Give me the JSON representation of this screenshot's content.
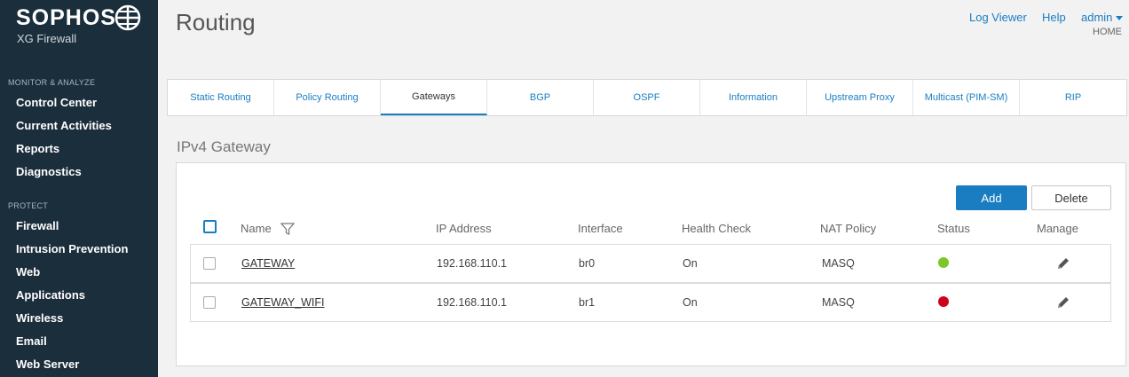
{
  "brand": {
    "name": "SOPHOS",
    "product": "XG Firewall"
  },
  "sidebar": {
    "sections": [
      {
        "label": "MONITOR & ANALYZE",
        "items": [
          "Control Center",
          "Current Activities",
          "Reports",
          "Diagnostics"
        ]
      },
      {
        "label": "PROTECT",
        "items": [
          "Firewall",
          "Intrusion Prevention",
          "Web",
          "Applications",
          "Wireless",
          "Email",
          "Web Server"
        ]
      }
    ]
  },
  "header": {
    "title": "Routing",
    "log_viewer": "Log Viewer",
    "help": "Help",
    "user": "admin",
    "breadcrumb": "HOME"
  },
  "tabs": [
    "Static Routing",
    "Policy Routing",
    "Gateways",
    "BGP",
    "OSPF",
    "Information",
    "Upstream Proxy",
    "Multicast (PIM-SM)",
    "RIP"
  ],
  "active_tab": "Gateways",
  "section": {
    "title": "IPv4 Gateway"
  },
  "actions": {
    "add": "Add",
    "delete": "Delete"
  },
  "table": {
    "columns": [
      "Name",
      "IP Address",
      "Interface",
      "Health Check",
      "NAT Policy",
      "Status",
      "Manage"
    ],
    "rows": [
      {
        "name": "GATEWAY",
        "ip": "192.168.110.1",
        "interface": "br0",
        "health": "On",
        "nat": "MASQ",
        "status": "up",
        "status_color": "#7cc627"
      },
      {
        "name": "GATEWAY_WIFI",
        "ip": "192.168.110.1",
        "interface": "br1",
        "health": "On",
        "nat": "MASQ",
        "status": "down",
        "status_color": "#d0021b"
      }
    ]
  },
  "colors": {
    "sidebar_bg": "#1b2e3c",
    "accent": "#1a7dc2"
  }
}
